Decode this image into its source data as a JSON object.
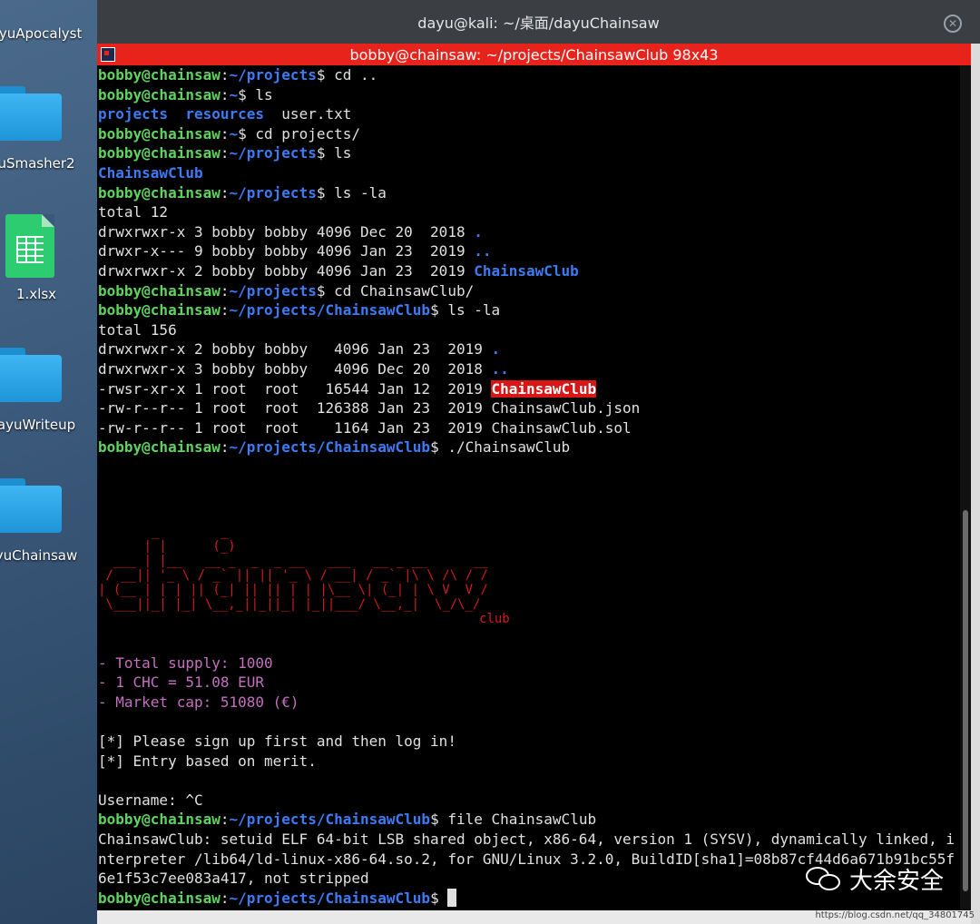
{
  "desktop": {
    "icons": [
      {
        "label": "ayuApocalyst",
        "kind": "folder-partial"
      },
      {
        "label": "uSmasher2",
        "kind": "folder"
      },
      {
        "label": "1.xlsx",
        "kind": "spreadsheet"
      },
      {
        "label": "ayuWriteup",
        "kind": "folder"
      },
      {
        "label": "yuChainsaw",
        "kind": "folder"
      }
    ]
  },
  "outer_window": {
    "title": "dayu@kali: ~/桌面/dayuChainsaw",
    "close_icon": "close-icon"
  },
  "terminal": {
    "title": "bobby@chainsaw: ~/projects/ChainsawClub 98x43",
    "prompt_user": "bobby@chainsaw",
    "lines": [
      {
        "p": "~/projects",
        "cmd": "cd .."
      },
      {
        "p": "~",
        "cmd": "ls"
      },
      {
        "out": "projects  resources  user.txt"
      },
      {
        "p": "~",
        "cmd": "cd projects/"
      },
      {
        "p": "~/projects",
        "cmd": "ls"
      },
      {
        "out": "ChainsawClub"
      },
      {
        "p": "~/projects",
        "cmd": "ls -la"
      },
      {
        "out": "total 12"
      },
      {
        "out": "drwxrwxr-x 3 bobby bobby 4096 Dec 20  2018 ."
      },
      {
        "out": "drwxr-x--- 9 bobby bobby 4096 Jan 23  2019 .."
      },
      {
        "out": "drwxrwxr-x 2 bobby bobby 4096 Jan 23  2019 ChainsawClub"
      },
      {
        "p": "~/projects",
        "cmd": "cd ChainsawClub/"
      },
      {
        "p": "~/projects/ChainsawClub",
        "cmd": "ls -la"
      },
      {
        "out": "total 156"
      },
      {
        "out": "drwxrwxr-x 2 bobby bobby   4096 Jan 23  2019 ."
      },
      {
        "out": "drwxrwxr-x 3 bobby bobby   4096 Dec 20  2018 .."
      },
      {
        "out": "-rwsr-xr-x 1 root  root   16544 Jan 12  2019 ChainsawClub"
      },
      {
        "out": "-rw-r--r-- 1 root  root  126388 Jan 23  2019 ChainsawClub.json"
      },
      {
        "out": "-rw-r--r-- 1 root  root    1164 Jan 23  2019 ChainsawClub.sol"
      },
      {
        "p": "~/projects/ChainsawClub",
        "cmd": "./ChainsawClub"
      }
    ],
    "banner_sub": "club",
    "info": [
      "- Total supply: 1000",
      "- 1 CHC = 51.08 EUR",
      "- Market cap: 51080 (€)"
    ],
    "notes": [
      "[*] Please sign up first and then log in!",
      "[*] Entry based on merit."
    ],
    "username_line": "Username: ^C",
    "file_cmd": {
      "p": "~/projects/ChainsawClub",
      "cmd": "file ChainsawClub"
    },
    "file_out": [
      "ChainsawClub: setuid ELF 64-bit LSB shared object, x86-64, version 1 (SYSV), dynamically linked, i",
      "nterpreter /lib64/ld-linux-x86-64.so.2, for GNU/Linux 3.2.0, BuildID[sha1]=08b87cf44d6a671b91bc55f",
      "6e1f53c7ee083a417, not stripped"
    ],
    "final_prompt": "~/projects/ChainsawClub"
  },
  "watermark": {
    "text": "大余安全",
    "csdn": "https://blog.csdn.net/qq_34801745"
  },
  "colors": {
    "prompt": "#5fd35f",
    "dir": "#3d7bf5",
    "titlebar": "#e8231c",
    "banner": "#d11b1b",
    "info": "#c46fbf"
  }
}
